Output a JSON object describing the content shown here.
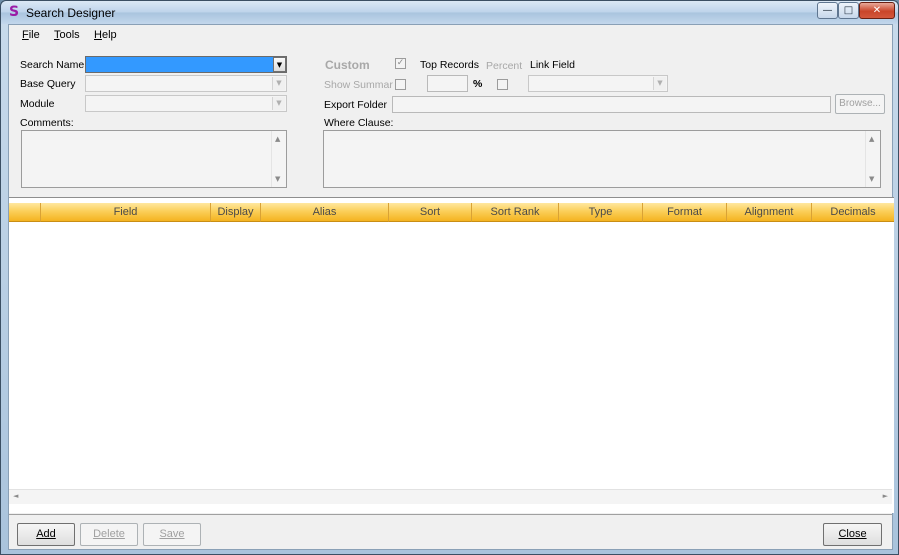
{
  "window": {
    "title": "Search Designer",
    "app_icon": "S"
  },
  "menu": [
    {
      "label": "File",
      "mnemonic": "F",
      "rest": "ile"
    },
    {
      "label": "Tools",
      "mnemonic": "T",
      "rest": "ools"
    },
    {
      "label": "Help",
      "mnemonic": "H",
      "rest": "elp"
    }
  ],
  "form": {
    "search_name_label": "Search Name",
    "base_query_label": "Base Query",
    "module_label": "Module",
    "comments_label": "Comments:",
    "custom_label": "Custom",
    "custom_checked": true,
    "top_records_label": "Top Records",
    "percent_label": "Percent",
    "link_field_label": "Link Field",
    "show_summary_label": "Show Summar",
    "percent_sign": "%",
    "export_folder_label": "Export Folder",
    "browse_label": "Browse...",
    "where_clause_label": "Where Clause:"
  },
  "grid": {
    "columns": [
      "",
      "Field",
      "Display",
      "Alias",
      "Sort",
      "Sort Rank",
      "Type",
      "Format",
      "Alignment",
      "Decimals"
    ]
  },
  "buttons": {
    "add": "Add",
    "delete": "Delete",
    "save": "Save",
    "close": "Close"
  },
  "colors": {
    "selection": "#3399ff",
    "grid_header": "#fbcf5a"
  }
}
